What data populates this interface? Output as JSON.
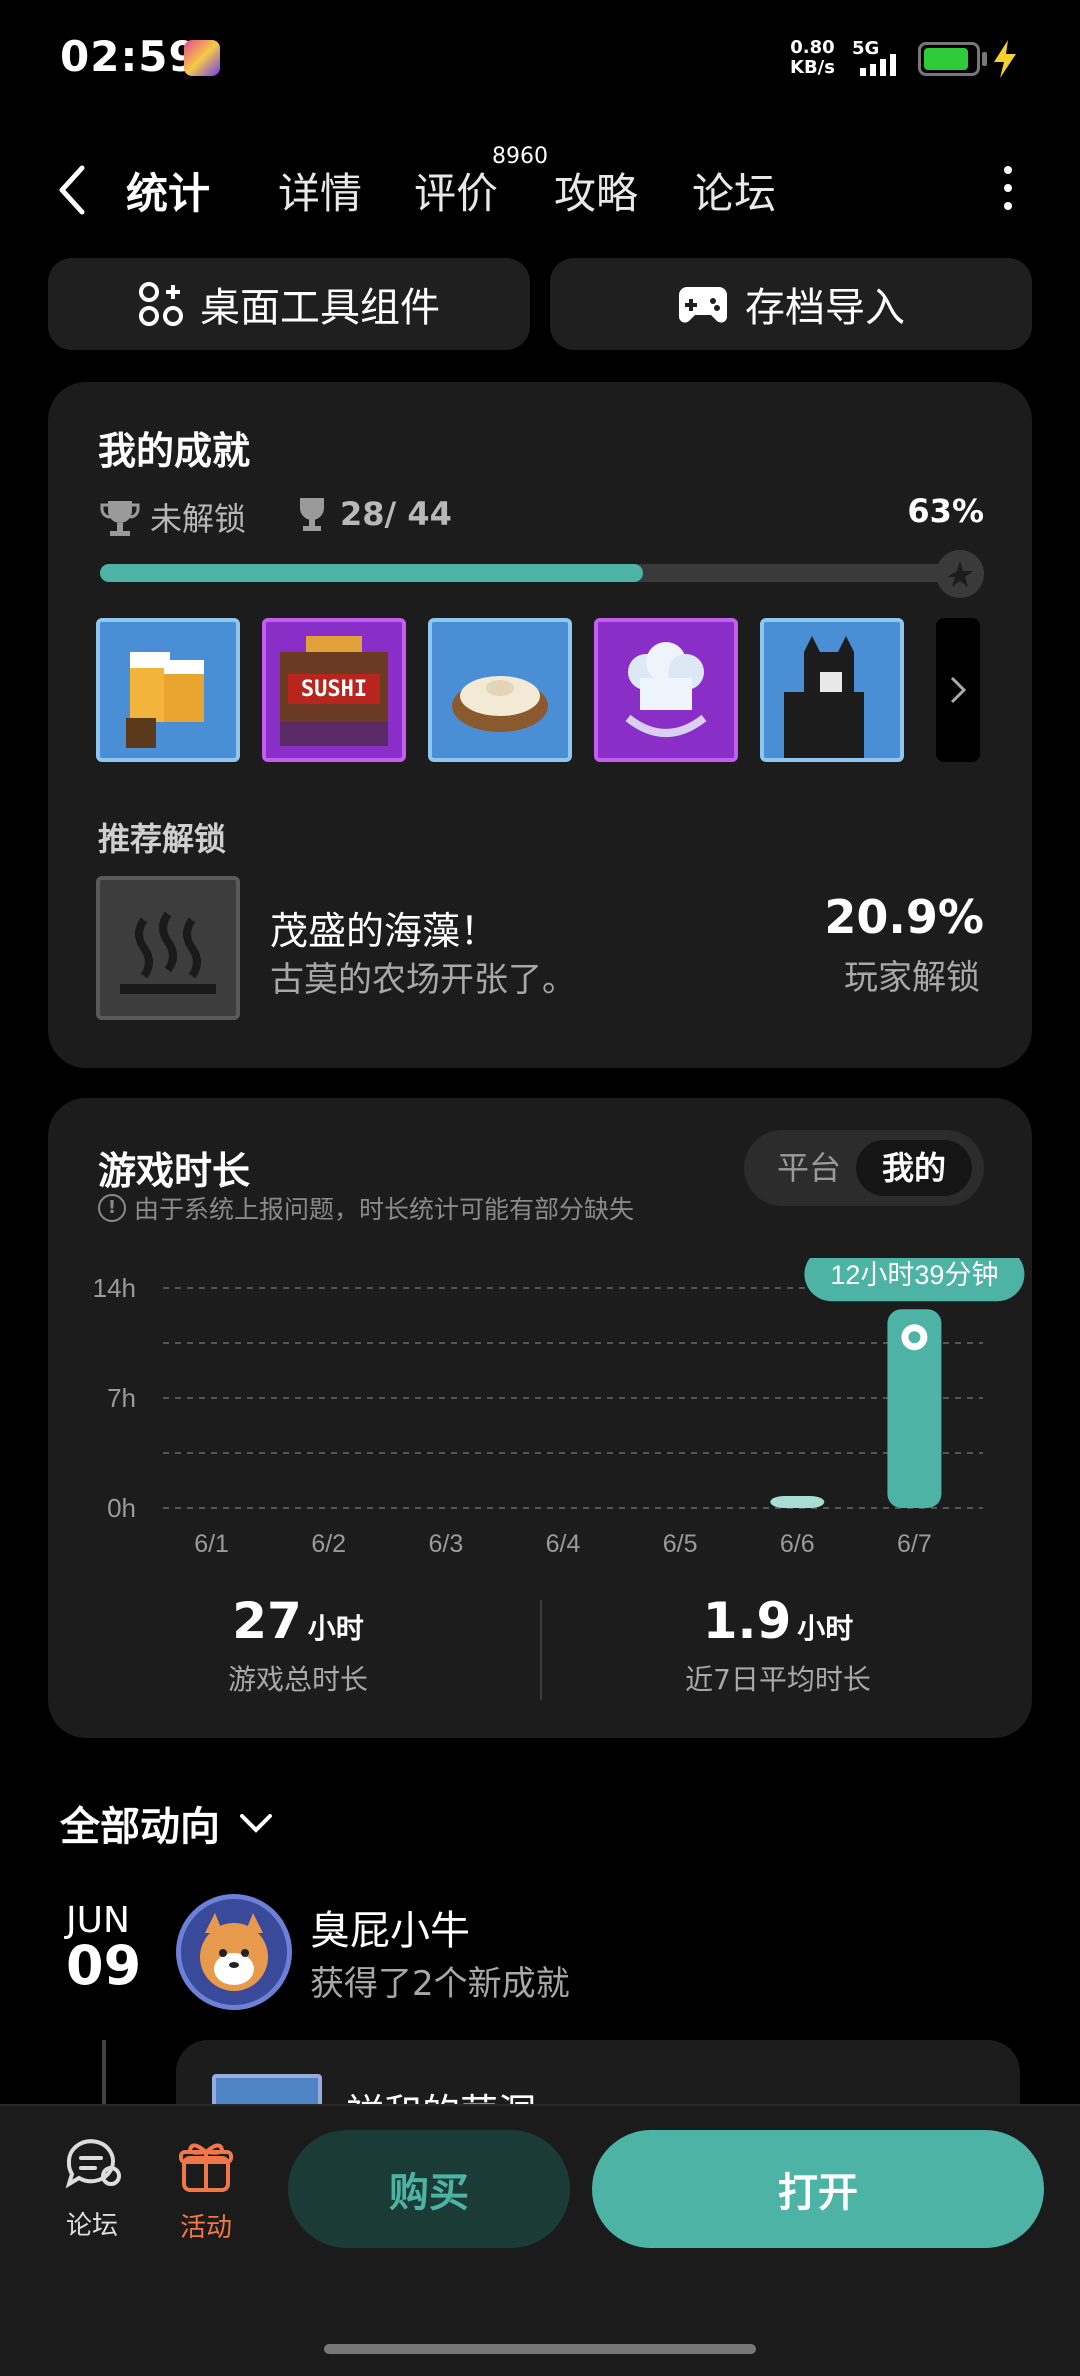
{
  "status_bar": {
    "time": "02:59",
    "net_speed_value": "0.80",
    "net_speed_unit": "KB/s",
    "network": "5G",
    "battery_color": "#2ecc3a"
  },
  "nav": {
    "tabs": [
      "统计",
      "详情",
      "评价",
      "攻略",
      "论坛"
    ],
    "active_tab": "统计",
    "review_count": "8960"
  },
  "tools": {
    "widget_label": "桌面工具组件",
    "save_import_label": "存档导入"
  },
  "achievements": {
    "title": "我的成就",
    "locked_label": "未解锁",
    "count": "28/ 44",
    "percent": "63%",
    "progress": 0.63,
    "icons": [
      "beer-achievement-icon",
      "sushi-achievement-icon",
      "dumpling-achievement-icon",
      "chef-hat-achievement-icon",
      "cat-achievement-icon"
    ],
    "recommend_label": "推荐解锁",
    "recommend": {
      "name": "茂盛的海藻！",
      "desc": "古莫的农场开张了。",
      "percent": "20.9%",
      "percent_label": "玩家解锁"
    }
  },
  "playtime": {
    "title": "游戏时长",
    "toggle": {
      "off": "平台",
      "on": "我的"
    },
    "note": "由于系统上报问题，时长统计可能有部分缺失",
    "tooltip": "12小时39分钟",
    "total_value": "27",
    "total_unit": "小时",
    "total_label": "游戏总时长",
    "avg_value": "1.9",
    "avg_unit": "小时",
    "avg_label": "近7日平均时长"
  },
  "chart_data": {
    "type": "bar",
    "categories": [
      "6/1",
      "6/2",
      "6/3",
      "6/4",
      "6/5",
      "6/6",
      "6/7"
    ],
    "values": [
      0,
      0,
      0,
      0,
      0,
      0.3,
      12.65
    ],
    "y_ticks": [
      "0h",
      "7h",
      "14h"
    ],
    "ylim": [
      0,
      14
    ],
    "grid": true,
    "bar_color": "#4db3a4",
    "highlight_color": "#a8ddd6"
  },
  "feed": {
    "header": "全部动向",
    "month": "JUN",
    "day": "09",
    "user": "臭屁小牛",
    "action": "获得了2个新成就",
    "card_title": "祥和的营洞"
  },
  "bottom": {
    "forum_label": "论坛",
    "activity_label": "活动",
    "buy_label": "购买",
    "open_label": "打开",
    "accent": "#4db3a4",
    "activity_color": "#f07848"
  }
}
